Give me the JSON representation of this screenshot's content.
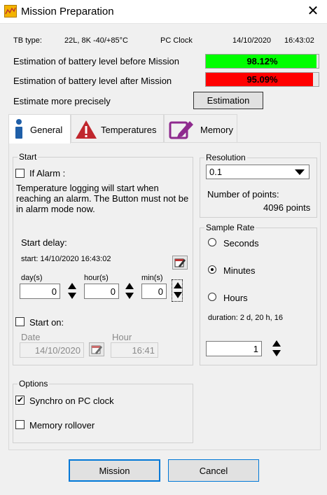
{
  "window": {
    "title": "Mission Preparation",
    "close_glyph": "✕"
  },
  "info": {
    "tb_type_label": "TB type:",
    "tb_type_value": "22L, 8K -40/+85°C",
    "pc_clock_label": "PC Clock",
    "pc_date": "14/10/2020",
    "pc_time": "16:43:02"
  },
  "battery": {
    "before_label": "Estimation of battery level before Mission",
    "before_value": "98.12%",
    "before_fraction": 0.9812,
    "before_color": "#00ff00",
    "after_label": "Estimation of battery level after Mission",
    "after_value": "95.09%",
    "after_fraction": 0.9509,
    "after_color": "#ff0000"
  },
  "estimate": {
    "label": "Estimate more precisely",
    "button": "Estimation"
  },
  "tabs": [
    {
      "label": "General",
      "icon": "info-icon",
      "active": true
    },
    {
      "label": "Temperatures",
      "icon": "warning-icon",
      "active": false
    },
    {
      "label": "Memory",
      "icon": "edit-icon",
      "active": false
    }
  ],
  "start": {
    "legend": "Start",
    "if_alarm_label": "If Alarm :",
    "if_alarm_checked": false,
    "alarm_description": "Temperature logging will start when reaching an alarm. The Button must not be in alarm mode now.",
    "delay_label": "Start delay:",
    "start_text": "start: 14/10/2020 16:43:02",
    "days_label": "day(s)",
    "days_value": "0",
    "hours_label": "hour(s)",
    "hours_value": "0",
    "mins_label": "min(s)",
    "mins_value": "0",
    "start_on_label": "Start on:",
    "start_on_checked": false,
    "date_label": "Date",
    "date_value": "14/10/2020",
    "hour_label": "Hour",
    "hour_value": "16:41"
  },
  "resolution": {
    "legend": "Resolution",
    "selected": "0.1",
    "points_label": "Number of points:",
    "points_value": "4096 points"
  },
  "sample_rate": {
    "legend": "Sample Rate",
    "options": [
      "Seconds",
      "Minutes",
      "Hours"
    ],
    "selected_index": 1,
    "duration": "duration: 2 d, 20 h, 16",
    "value": "1"
  },
  "options": {
    "legend": "Options",
    "synchro_label": "Synchro on PC clock",
    "synchro_checked": true,
    "rollover_label": "Memory rollover",
    "rollover_checked": false
  },
  "footer": {
    "mission_button": "Mission",
    "cancel_button": "Cancel"
  }
}
